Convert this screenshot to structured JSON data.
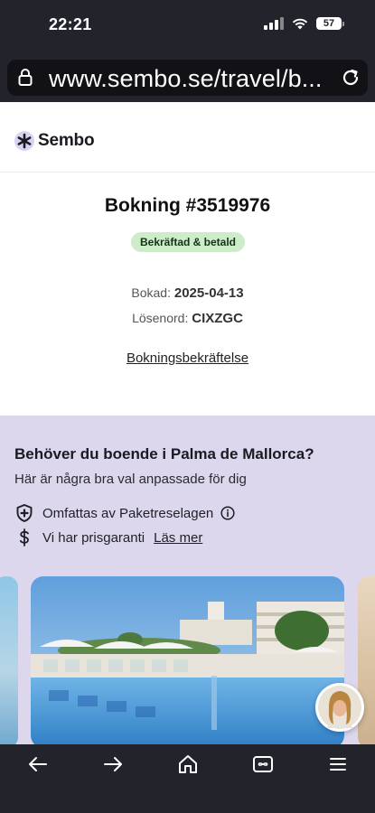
{
  "status_bar": {
    "time": "22:21",
    "battery": "57"
  },
  "browser": {
    "url": "www.sembo.se/travel/b..."
  },
  "header": {
    "logo_text": "Sembo"
  },
  "booking": {
    "title": "Bokning #3519976",
    "status_badge": "Bekräftad & betald",
    "booked_label": "Bokad:",
    "booked_value": "2025-04-13",
    "password_label": "Lösenord:",
    "password_value": "CIXZGC",
    "confirmation_link": "Bokningsbekräftelse"
  },
  "promo": {
    "title": "Behöver du boende i Palma de Mallorca?",
    "subtitle": "Här är några bra val anpassade för dig",
    "feature_1": "Omfattas av Paketreselagen",
    "feature_2": "Vi har prisgaranti",
    "read_more": "Läs mer"
  },
  "colors": {
    "chrome": "#23232b",
    "badge_bg": "#cdecc9",
    "promo_bg": "#dcd7ec"
  },
  "icons": {
    "lock": "lock-icon",
    "reload": "reload-icon",
    "shield": "shield-plus-icon",
    "dollar": "dollar-icon",
    "info": "info-icon",
    "back": "arrow-left-icon",
    "forward": "arrow-right-icon",
    "home": "home-icon",
    "tabs": "tabs-icon",
    "menu": "menu-icon"
  }
}
